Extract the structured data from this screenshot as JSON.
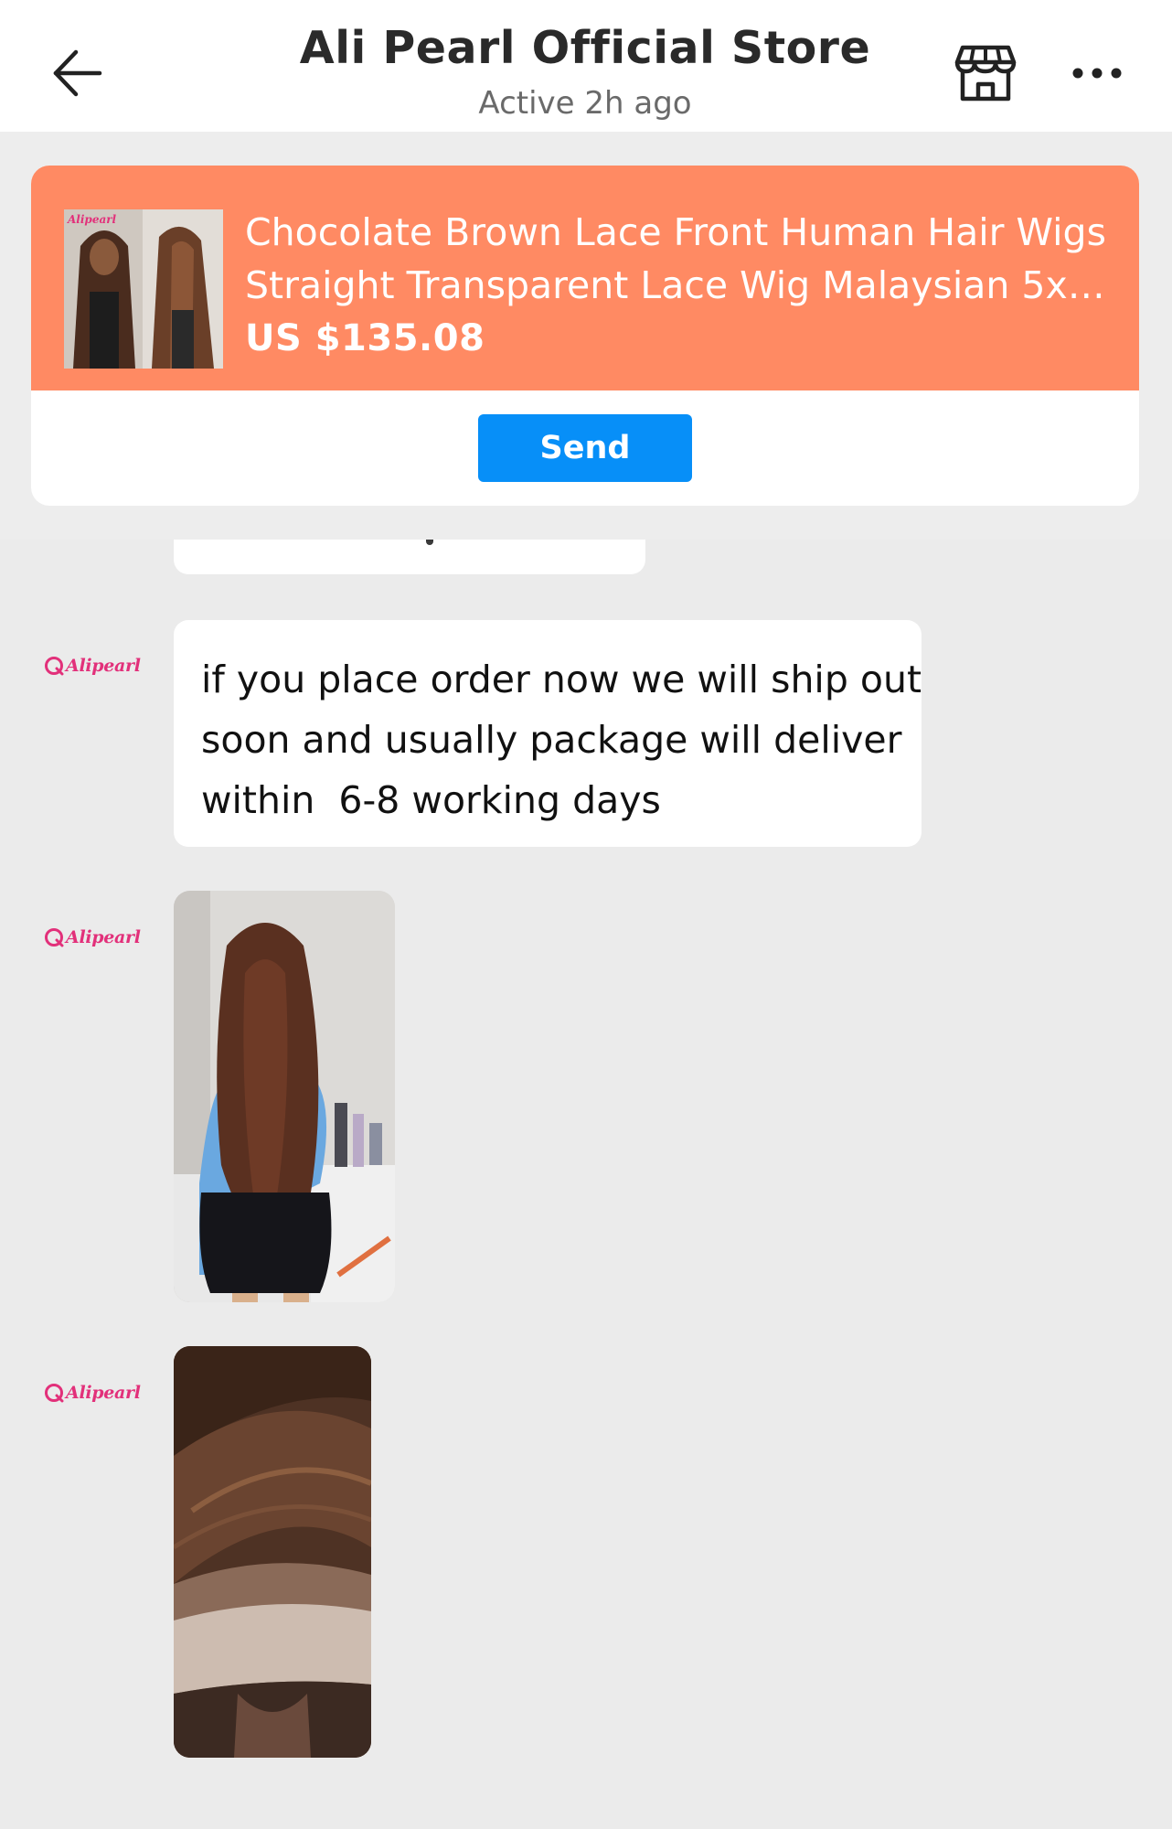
{
  "header": {
    "title": "Ali Pearl Official Store",
    "status": "Active 2h ago",
    "icons": {
      "back": "arrow-left-icon",
      "store": "storefront-icon",
      "more": "more-horizontal-icon"
    }
  },
  "product": {
    "name_line1": "Chocolate Brown Lace Front Human Hair Wigs",
    "name_line2": "Straight Transparent Lace Wig Malaysian 5x5 L...",
    "price": "US $135.08",
    "send_label": "Send",
    "thumb_logo": "Alipearl"
  },
  "colors": {
    "accent": "#ff8a63",
    "button": "#078ff8",
    "brand": "#e2307a",
    "chat_bg": "#ebebeb"
  },
  "messages": [
    {
      "sender_logo": "Alipearl",
      "type": "text",
      "lines": [
        "if you place order now we will ship out",
        "soon and usually package will deliver",
        "within  6-8 working days"
      ]
    },
    {
      "sender_logo": "Alipearl",
      "type": "image",
      "content": "photo of long straight brown hair wig, back view"
    },
    {
      "sender_logo": "Alipearl",
      "type": "image",
      "content": "close-up photo of transparent lace front hairline"
    }
  ]
}
